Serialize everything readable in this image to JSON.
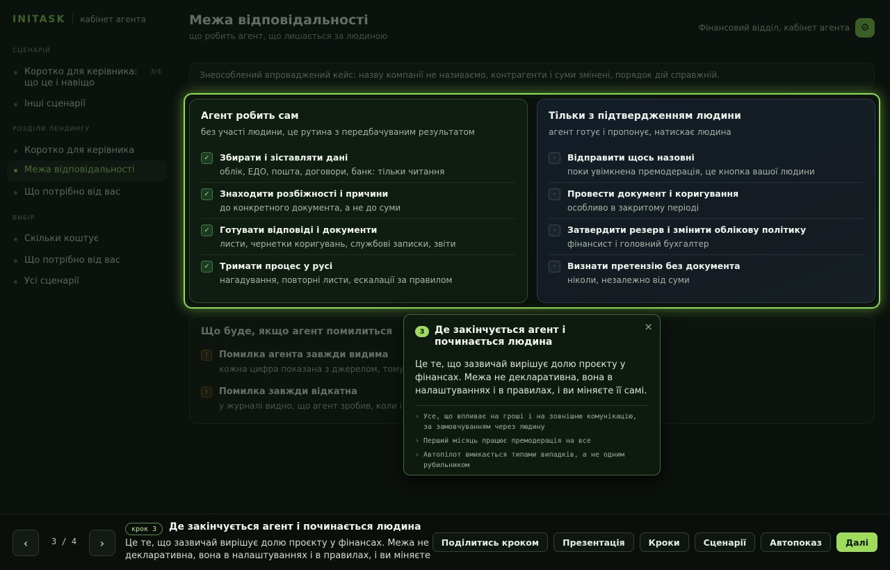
{
  "sidebar": {
    "logo": "INITASK",
    "subtitle": "кабінет агента",
    "sections": [
      {
        "title": "СЦЕНАРІЙ"
      },
      {
        "title": "РОЗДІЛИ ЛЕНДИНГУ"
      },
      {
        "title": "ВИБІР"
      }
    ],
    "items": [
      {
        "label": "Коротко для керівника: що це і навіщо",
        "count": "3/4"
      },
      {
        "label": "Інші сценарії"
      },
      {
        "label": "Коротко для керівника"
      },
      {
        "label": "Межа відповідальності"
      },
      {
        "label": "Що потрібно від вас"
      },
      {
        "label": "Скільки коштує"
      },
      {
        "label": "Що потрібно від вас"
      },
      {
        "label": "Усі сценарії"
      }
    ]
  },
  "header": {
    "title": "Межа відповідальності",
    "subtitle": "що робить агент, що лишається за людиною",
    "right_label": "Фінансовий відділ, кабінет агента",
    "avatar": "⚙"
  },
  "notice": "Знеособлений впроваджений кейс: назву компанії не називаємо, контрагенти і суми змінені, порядок дій справжній.",
  "left_col": {
    "title": "Агент робить сам",
    "subtitle": "без участі людини, це рутина з передбачуваним результатом",
    "rows": [
      {
        "title": "Збирати і зіставляти дані",
        "desc": "облік, ЕДО, пошта, договори, банк: тільки читання"
      },
      {
        "title": "Знаходити розбіжності і причини",
        "desc": "до конкретного документа, а не до суми"
      },
      {
        "title": "Готувати відповіді і документи",
        "desc": "листи, чернетки коригувань, службові записки, звіти"
      },
      {
        "title": "Тримати процес у русі",
        "desc": "нагадування, повторні листи, ескалації за правилом"
      }
    ]
  },
  "right_col": {
    "title": "Тільки з підтвердженням людини",
    "subtitle": "агент готує і пропонує, натискає людина",
    "rows": [
      {
        "title": "Відправити щось назовні",
        "desc": "поки увімкнена премодерація, це кнопка вашої людини"
      },
      {
        "title": "Провести документ і коригування",
        "desc": "особливо в закритому періоді"
      },
      {
        "title": "Затвердити резерв і змінити облікову політику",
        "desc": "фінансист і головний бухгалтер"
      },
      {
        "title": "Визнати претензію без документа",
        "desc": "ніколи, незалежно від суми"
      }
    ]
  },
  "lower": {
    "title": "Що буде, якщо агент помилиться",
    "rows": [
      {
        "title": "Помилка агента завжди видима",
        "desc": "кожна цифра показана з джерелом, тому н"
      },
      {
        "title": "Помилка завжди відкатна",
        "desc": "у журналі видно, що агент зробив, коли і н"
      }
    ]
  },
  "popover": {
    "step": "3",
    "title": "Де закінчується агент і починається людина",
    "body": "Це те, що зазвичай вирішує долю проєкту у фінансах. Межа не декларативна, вона в налаштуваннях і в правилах, і ви міняєте її самі.",
    "list": [
      "Усе, що впливає на гроші і на зовнішню комунікацію, за замовчуванням через людину",
      "Перший місяць працює премодерація на все",
      "Автопілот вмикається типами випадків, а не одним рубильником"
    ],
    "close": "×"
  },
  "bottom": {
    "prev": "‹",
    "next": "›",
    "counter": "3 / 4",
    "step_pill": "крок 3",
    "step_title": "Де закінчується агент і починається людина",
    "step_desc": "Це те, що зазвичай вирішує долю проєкту у фінансах. Межа не декларативна, вона в налаштуваннях і в правилах, і ви міняєте її…",
    "actions": [
      "Поділитись кроком",
      "Презентація",
      "Кроки",
      "Сценарії",
      "Автопоказ",
      "Далі"
    ]
  },
  "colors": {
    "accent": "#9fdc5e",
    "background": "#0b110c"
  }
}
